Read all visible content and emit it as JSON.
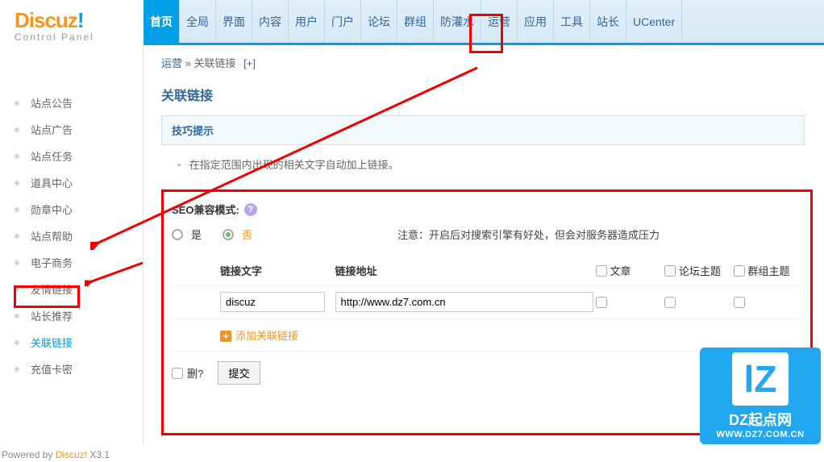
{
  "logo": {
    "main": "Discuz",
    "excl": "!",
    "sub": "Control Panel"
  },
  "topnav": [
    "首页",
    "全局",
    "界面",
    "内容",
    "用户",
    "门户",
    "论坛",
    "群组",
    "防灌水",
    "运营",
    "应用",
    "工具",
    "站长",
    "UCenter"
  ],
  "topnav_active_index": 0,
  "sidebar": [
    "站点公告",
    "站点广告",
    "站点任务",
    "道具中心",
    "勋章中心",
    "站点帮助",
    "电子商务",
    "友情链接",
    "站长推荐",
    "关联链接",
    "充值卡密"
  ],
  "sidebar_selected_index": 9,
  "breadcrumb": {
    "a": "运营",
    "sep": "»",
    "b": "关联链接",
    "plus": "[+]"
  },
  "page_title": "关联链接",
  "tips_title": "技巧提示",
  "desc": "在指定范围内出现的相关文字自动加上链接。",
  "seo": {
    "label": "SEO兼容模式:",
    "yes": "是",
    "no": "否",
    "help": "?",
    "note": "注意：开启后对搜索引擎有好处，但会对服务器造成压力"
  },
  "table": {
    "th_text": "链接文字",
    "th_url": "链接地址",
    "th_article": "文章",
    "th_forum": "论坛主题",
    "th_group": "群组主题",
    "row": {
      "text": "discuz",
      "url": "http://www.dz7.com.cn"
    },
    "add": "添加关联链接"
  },
  "submit": {
    "del": "删?",
    "btn": "提交"
  },
  "watermark": {
    "lz": "lZ",
    "text": "DZ起点网",
    "url": "WWW.DZ7.COM.CN"
  },
  "footer": {
    "p1": "Powered by ",
    "p2": "Discuz!",
    "p3": " X3.1"
  }
}
